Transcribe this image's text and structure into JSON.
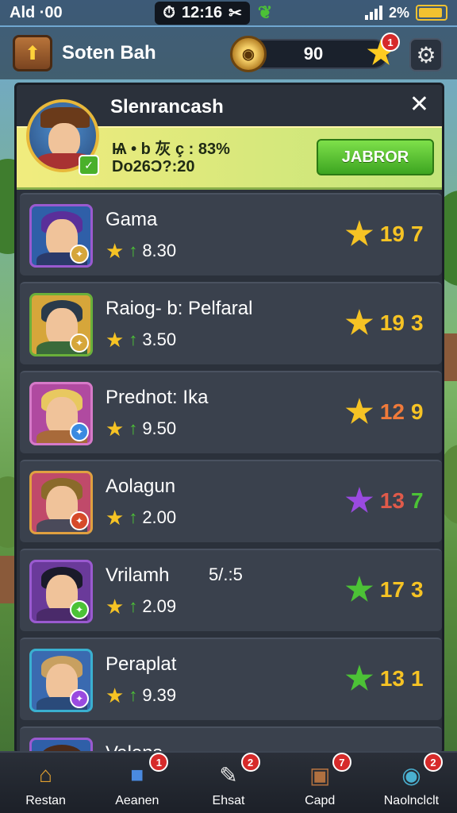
{
  "status_bar": {
    "carrier": "Ald ·00",
    "time": "12:16",
    "time_icon": "alarm-icon",
    "x_icon": "scissors-icon",
    "battery_percent": "2%",
    "battery_level": 0.9
  },
  "header": {
    "title": "Soten Bah",
    "coins": "90",
    "star_badge": "1",
    "colors": {
      "bar": "#1a212c",
      "star": "#ffcc22"
    }
  },
  "panel": {
    "title": "Slenrancash",
    "featured": {
      "line1": "Ѩ • b 灰 ç : 83%",
      "line2": "Do26Ɔ?:20",
      "button_label": "JABROR"
    },
    "rows": [
      {
        "name": "Gama",
        "stat": "8.30",
        "score_num": "19",
        "score_tail": "7",
        "star_color": "#f6c324",
        "num_color": "#f6c324",
        "tail_color": "#f6c324",
        "frame": "#9a5ad0",
        "hair": "#5a2f9a",
        "body": "#2b3a6a",
        "mini": "#d6a63a",
        "bg": "#2f5fa8",
        "extra": ""
      },
      {
        "name": "Raiog- b: Pelfaral",
        "stat": "3.50",
        "score_num": "19",
        "score_tail": "3",
        "star_color": "#f6c324",
        "num_color": "#f6c324",
        "tail_color": "#f6c324",
        "frame": "#6ab03a",
        "hair": "#2a3a4a",
        "body": "#3a6a3a",
        "mini": "#d6a63a",
        "bg": "#d6a63a",
        "extra": ""
      },
      {
        "name": "Prednot: Ika",
        "stat": "9.50",
        "score_num": "12",
        "score_tail": "9",
        "star_color": "#f6c324",
        "num_color": "#f07a3a",
        "tail_color": "#f6c324",
        "frame": "#d67ac8",
        "hair": "#e8c860",
        "body": "#a86a3a",
        "mini": "#3a8ae0",
        "bg": "#b04aa0",
        "extra": ""
      },
      {
        "name": "Aolagun",
        "stat": "2.00",
        "score_num": "13",
        "score_tail": "7",
        "star_color": "#9a4ae0",
        "num_color": "#e05a4a",
        "tail_color": "#4cc236",
        "frame": "#e0a040",
        "hair": "#8a6a2a",
        "body": "#4a4a5a",
        "mini": "#d64a2a",
        "bg": "#c04a6a",
        "extra": ""
      },
      {
        "name": "Vrilamh",
        "stat": "2.09",
        "score_num": "17",
        "score_tail": "3",
        "star_color": "#4cc236",
        "num_color": "#f6c324",
        "tail_color": "#f6c324",
        "frame": "#9a5ad0",
        "hair": "#1a1a2a",
        "body": "#4a2a6a",
        "mini": "#4cc236",
        "bg": "#6a3a9a",
        "extra": "5/.:5"
      },
      {
        "name": "Peraplat",
        "stat": "9.39",
        "score_num": "13",
        "score_tail": "1",
        "star_color": "#4cc236",
        "num_color": "#f6c324",
        "tail_color": "#f6c324",
        "frame": "#3ab0d0",
        "hair": "#c8a060",
        "body": "#2a4a7a",
        "mini": "#9a4ae0",
        "bg": "#3a6ab0",
        "extra": ""
      },
      {
        "name": "Valens",
        "stat": "",
        "score_num": "",
        "score_tail": "",
        "star_color": "#f6c324",
        "num_color": "#f6c324",
        "tail_color": "#f6c324",
        "frame": "#9a5ad0",
        "hair": "#4a2a1a",
        "body": "#2a2a4a",
        "mini": "#d6a63a",
        "bg": "#2f5fa8",
        "extra": ""
      }
    ]
  },
  "nav": [
    {
      "label": "Restan",
      "icon": "house-icon",
      "glyph": "⌂",
      "badge": "",
      "color": "#e0a030"
    },
    {
      "label": "Aeanen",
      "icon": "cube-icon",
      "glyph": "■",
      "badge": "1",
      "color": "#4a8ae0"
    },
    {
      "label": "Ehsat",
      "icon": "chat-icon",
      "glyph": "✎",
      "badge": "2",
      "color": "#e8e8e8"
    },
    {
      "label": "Capd",
      "icon": "box-icon",
      "glyph": "▣",
      "badge": "7",
      "color": "#b07040"
    },
    {
      "label": "Naolnclclt",
      "icon": "globe-icon",
      "glyph": "◉",
      "badge": "2",
      "color": "#4ab0d0"
    }
  ]
}
